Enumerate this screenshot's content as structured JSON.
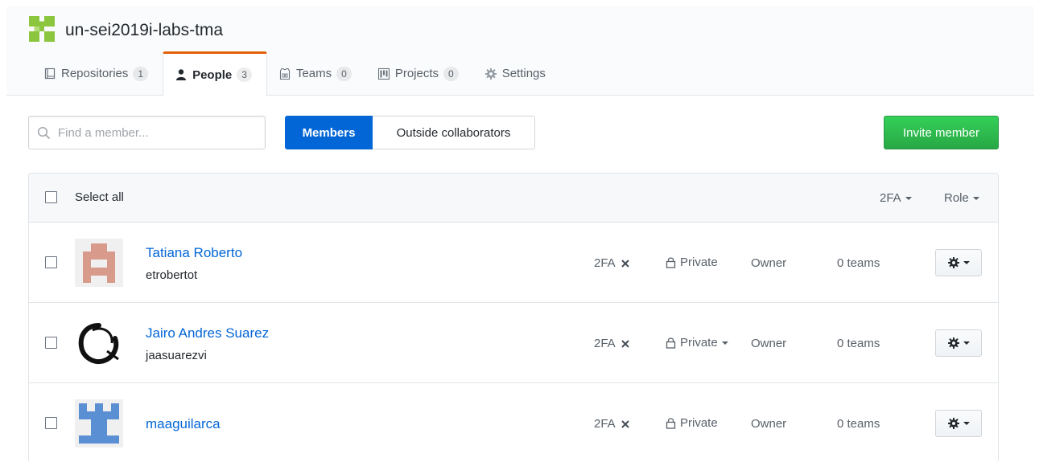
{
  "org": {
    "name": "un-sei2019i-labs-tma"
  },
  "tabs": [
    {
      "label": "Repositories",
      "count": "1"
    },
    {
      "label": "People",
      "count": "3"
    },
    {
      "label": "Teams",
      "count": "0"
    },
    {
      "label": "Projects",
      "count": "0"
    },
    {
      "label": "Settings"
    }
  ],
  "search": {
    "placeholder": "Find a member..."
  },
  "segmented": {
    "members": "Members",
    "outside": "Outside collaborators"
  },
  "invite_label": "Invite member",
  "table": {
    "select_all": "Select all",
    "filter_2fa": "2FA",
    "filter_role": "Role"
  },
  "members": [
    {
      "name": "Tatiana Roberto",
      "login": "etrobertot",
      "twofa": "2FA",
      "visibility": "Private",
      "role": "Owner",
      "teams": "0 teams"
    },
    {
      "name": "Jairo Andres Suarez",
      "login": "jaasuarezvi",
      "twofa": "2FA",
      "visibility": "Private",
      "role": "Owner",
      "teams": "0 teams"
    },
    {
      "name": "maaguilarca",
      "twofa": "2FA",
      "visibility": "Private",
      "role": "Owner",
      "teams": "0 teams"
    }
  ],
  "colors": {
    "accent_tab": "#e36209",
    "link": "#0366d6",
    "primary": "#0366d6",
    "success": "#28a745"
  }
}
